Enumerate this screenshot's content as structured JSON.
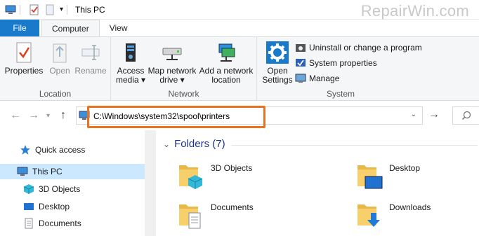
{
  "window": {
    "title": "This PC"
  },
  "watermark": "RepairWin.com",
  "tabs": [
    {
      "label": "File"
    },
    {
      "label": "Computer"
    },
    {
      "label": "View"
    }
  ],
  "ribbon": {
    "location": {
      "label": "Location",
      "properties": "Properties",
      "open": "Open",
      "rename": "Rename"
    },
    "network": {
      "label": "Network",
      "access_media_1": "Access",
      "access_media_2": "media ▾",
      "map_drive_1": "Map network",
      "map_drive_2": "drive ▾",
      "add_location_1": "Add a network",
      "add_location_2": "location"
    },
    "system": {
      "label": "System",
      "open_settings_1": "Open",
      "open_settings_2": "Settings",
      "uninstall": "Uninstall or change a program",
      "properties": "System properties",
      "manage": "Manage"
    }
  },
  "address": {
    "path": "C:\\Windows\\system32\\spool\\printers"
  },
  "nav": {
    "quick_access": "Quick access",
    "this_pc": "This PC",
    "objects3d": "3D Objects",
    "desktop": "Desktop",
    "documents": "Documents"
  },
  "content": {
    "section": "Folders (7)",
    "folders": [
      "3D Objects",
      "Desktop",
      "Documents",
      "Downloads"
    ]
  },
  "colors": {
    "accent": "#1979ca",
    "highlight": "#e8721e",
    "selected": "#cce8ff"
  }
}
